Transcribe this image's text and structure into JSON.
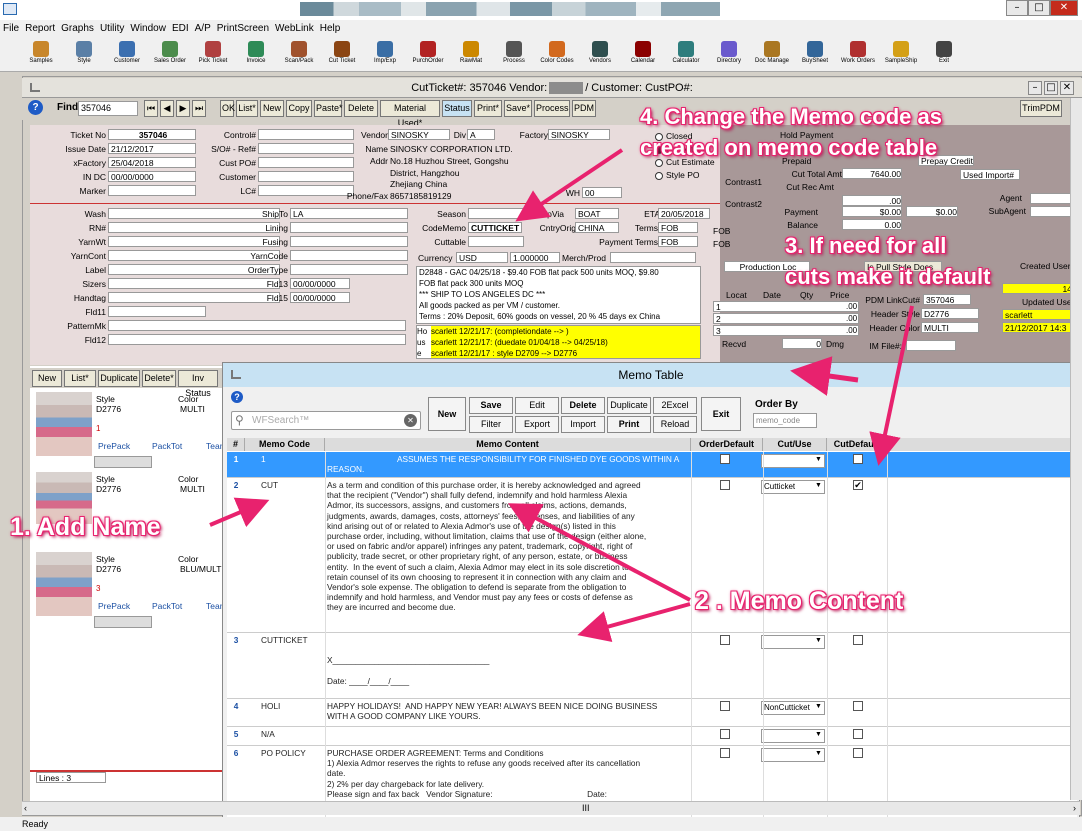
{
  "menu": [
    "File",
    "Report",
    "Graphs",
    "Utility",
    "Window",
    "EDI",
    "A/P",
    "PrintScreen",
    "WebLink",
    "Help"
  ],
  "toolbar": [
    "Samples",
    "Style",
    "Customer",
    "Sales Order",
    "Pick Ticket",
    "Invoice",
    "Scan/Pack",
    "Cut Ticket",
    "Imp/Exp",
    "PurchOrder",
    "RawMat",
    "Process",
    "Color Codes",
    "Vendors",
    "Calendar",
    "Calculator",
    "Directory",
    "Doc Manage",
    "BuySheet",
    "Work Orders",
    "SampleShip",
    "Exit"
  ],
  "subwindow_title": "CutTicket#: 357046 Vendor:",
  "subwindow_title2": "/ Customer: CustPO#:",
  "find": {
    "label": "Find",
    "value": "357046",
    "buttons": [
      "OK",
      "List*",
      "New",
      "Copy",
      "Paste*",
      "Delete",
      "Material Used*",
      "Status",
      "Print*",
      "Save*",
      "Process",
      "PDM"
    ],
    "right": "TrimPDM"
  },
  "form": {
    "ticket_no_label": "Ticket No",
    "ticket_no": "357046",
    "issue_date_label": "Issue Date",
    "issue_date": "21/12/2017",
    "xfactory_label": "xFactory",
    "xfactory": "25/04/2018",
    "in_dc_label": "IN DC",
    "in_dc": "00/00/0000",
    "marker_label": "Marker",
    "control_label": "Control#",
    "so_label": "S/O# - Ref#",
    "cust_po_label": "Cust PO#",
    "customer_label": "Customer",
    "lc_label": "LC#",
    "vendor_label": "Vendor",
    "vendor_value": "SINOSKY",
    "div_label": "Div",
    "div_value": "A",
    "factory_label": "Factory",
    "factory_value": "SINOSKY",
    "name_label": "Name",
    "name_value": "SINOSKY CORPORATION LTD.",
    "addr_label": "Addr",
    "addr1": "No.18 Huzhou Street, Gongshu",
    "addr2": "District, Hangzhou",
    "addr3": "Zhejiang China",
    "phone_label": "Phone/Fax",
    "phone_value": "8657185819129",
    "wh_label": "WH",
    "wh_value": "00",
    "closed": "Closed",
    "cut_actual": "Cut Actual",
    "cut_estimate": "Cut Estimate",
    "style_po": "Style PO",
    "hold_payment": "Hold Payment",
    "prepaid_label": "Prepaid",
    "prepay_credit": "Prepay Credit",
    "cut_total_label": "Cut Total Amt",
    "cut_total": "7640.00",
    "cut_rec_label": "Cut Rec Amt",
    "cut_rec": ".00",
    "used_import": "Used Import#",
    "contrast1": "Contrast1",
    "contrast2": "Contrast2",
    "payment_label": "Payment",
    "payment1": "$0.00",
    "payment2": "$0.00",
    "balance_label": "Balance",
    "balance": "0.00",
    "agent_label": "Agent",
    "subagent_label": "SubAgent",
    "wash_label": "Wash",
    "rn_label": "RN#",
    "yarnwt_label": "YarnWt",
    "yarncont_label": "YarnCont",
    "label_label": "Label",
    "sizers_label": "Sizers",
    "handtag_label": "Handtag",
    "fld11_label": "Fld11",
    "patternmk_label": "PatternMk",
    "fld12_label": "Fld12",
    "shipto_label": "ShipTo",
    "shipto": "LA",
    "lining_label": "Lining",
    "fusing_label": "Fusing",
    "yarncode_label": "YarnCode",
    "ordertype_label": "OrderType",
    "fld13_label": "Fld13",
    "fld13": "00/00/0000",
    "fld15_label": "Fld15",
    "fld15": "00/00/0000",
    "season_label": "Season",
    "shipvia_label": "ShipVia",
    "shipvia": "BOAT",
    "eta_label": "ETA",
    "eta": "20/05/2018",
    "codememo_label": "CodeMemo",
    "codememo": "CUTTICKET",
    "cntryorig_label": "CntryOrig",
    "cntryorig": "CHINA",
    "terms_label": "Terms",
    "terms": "FOB",
    "fob1": "FOB",
    "cuttable_label": "Cuttable",
    "payterms_label": "Payment Terms",
    "payterms": "FOB",
    "fob2": "FOB",
    "currency_label": "Currency",
    "currency": "USD",
    "rate": "1.000000",
    "merch_label": "Merch/Prod",
    "notes": [
      "D2848 - GAC 04/25/18 - $9.40 FOB flat pack 500 units MOQ, $9.80",
      "FOB flat pack  300 units MOQ",
      "*** SHIP TO LOS ANGELES DC ***",
      "All goods packed as per VM / customer.",
      "Terms : 20% Deposit, 60% goods on vessel, 20 % 45 days ex China"
    ],
    "hist": [
      "scarlett 12/21/17: (completiondate --> )",
      "scarlett 12/21/17: (duedate 01/04/18 --> 04/25/18)",
      "scarlett 12/21/17 : style D2709 --> D2776"
    ],
    "hist_pre": [
      "Ho",
      "us",
      "e"
    ],
    "production_loc": "Production Loc",
    "locat": "Locat",
    "date": "Date",
    "qty": "Qty",
    "price": "Price",
    "recvd": "Recvd",
    "dmg": "Dmg",
    "loc_rows": [
      "1",
      "2",
      "3"
    ],
    "price_vals": [
      ".00",
      ".00",
      ".00"
    ],
    "dmg_val": "0",
    "is_pull": "Is Pull Style Docs",
    "pdm_linkcut_label": "PDM LinkCut#",
    "pdm_linkcut": "357046",
    "header_style_label": "Header Style",
    "header_style": "D2776",
    "header_color_label": "Header Color",
    "header_color": "MULTI",
    "im_file_label": "IM File#:",
    "created_user_label": "Created User",
    "created_user_val": "14:3",
    "updated_user_label": "Updated User",
    "updated_user": "scarlett",
    "updated_date": "21/12/2017 14:3"
  },
  "left": {
    "buttons": [
      "New",
      "List*",
      "Duplicate",
      "Delete*",
      "Inv Status"
    ],
    "items": [
      {
        "style_label": "Style",
        "color_label": "Color",
        "style": "D2776",
        "color": "MULTI",
        "n": "1",
        "links": [
          "PrePack",
          "PackTot",
          "Team"
        ]
      },
      {
        "style_label": "Style",
        "color_label": "Color",
        "style": "D2776",
        "color": "MULTI",
        "n": "",
        "links": []
      },
      {
        "style_label": "Style",
        "color_label": "Color",
        "style": "D2776",
        "color": "BLU/MULT",
        "n": "3",
        "links": [
          "PrePack",
          "PackTot",
          "Team"
        ]
      }
    ],
    "lines": "Lines : 3"
  },
  "memo": {
    "title": "Memo Table",
    "search_placeholder": "WFSearch™",
    "new": "New",
    "save": "Save",
    "edit": "Edit",
    "delete": "Delete",
    "duplicate": "Duplicate",
    "excel": "2Excel",
    "filter": "Filter",
    "export": "Export",
    "import": "Import",
    "print": "Print",
    "reload": "Reload",
    "exit": "Exit",
    "order_by": "Order By",
    "order_value": "memo_code",
    "headers": [
      "#",
      "Memo Code",
      "Memo Content",
      "OrderDefault",
      "Cut/Use",
      "CutDefault"
    ],
    "rows": [
      {
        "num": "1",
        "code": "1",
        "content": "ASSUMES THE RESPONSIBILITY FOR FINISHED DYE GOODS WITHIN A\nREASON.",
        "cut_use": "",
        "default": false
      },
      {
        "num": "2",
        "code": "CUT",
        "content": "As a term and condition of this purchase order, it is hereby acknowledged and agreed\nthat the recipient (\"Vendor\") shall fully defend, indemnify and hold harmless Alexia\nAdmor, its successors, assigns, and customers from all claims, actions, demands,\njudgments, awards, damages, costs, attorneys' fees, expenses, and liabilities of any\nkind arising out of or related to Alexia Admor's use of the design(s) listed in this\npurchase order, including, without limitation, claims that use of the design (either alone,\nor used on fabric and/or apparel) infringes any patent, trademark, copyright, right of\npublicity, trade secret, or other proprietary right, of any person, estate, or business\nentity.  In the event of such a claim, Alexia Admor may elect in its sole discretion to\nretain counsel of its own choosing to represent it in connection with any claim and\nVendor's sole expense. The obligation to defend is separate from the obligation to\nindemnify and hold harmless, and Vendor must pay any fees or costs of defense as\nthey are incurred and become due.",
        "cut_use": "Cutticket",
        "default": true
      },
      {
        "num": "3",
        "code": "CUTTICKET",
        "content": "\n\nX__________________________________\n\nDate: ____/____/____",
        "cut_use": "",
        "default": false
      },
      {
        "num": "4",
        "code": "HOLI",
        "content": "HAPPY HOLIDAYS!  AND HAPPY NEW YEAR! ALWAYS BEEN NICE DOING BUSINESS\nWITH A GOOD COMPANY LIKE YOURS.",
        "cut_use": "NonCutticket",
        "default": false
      },
      {
        "num": "5",
        "code": "N/A",
        "content": "",
        "cut_use": "",
        "default": false
      },
      {
        "num": "6",
        "code": "PO POLICY",
        "content": "PURCHASE ORDER AGREEMENT: Terms and Conditions\n1) Alexia Admor reserves the rights to refuse any goods received after its cancellation\ndate.\n2) 2% per day chargeback for late delivery.\nPlease sign and fax back   Vendor Signature:                                         Date:",
        "cut_use": "",
        "default": false
      }
    ]
  },
  "callouts": {
    "c1": "1. Add Name",
    "c2": "2 . Memo Content",
    "c3a": "3. If need for all",
    "c3b": "cuts make it default",
    "c4a": "4. Change the Memo code as",
    "c4b": "created on memo code table"
  },
  "status": "Ready",
  "colors": {
    "accent": "#e8226e",
    "selected_row": "#3399ff",
    "memo_header": "#c7e2f3",
    "form_bg": "#e8dcdc",
    "brown": "#a89898",
    "hist_yellow": "#ffff00"
  }
}
